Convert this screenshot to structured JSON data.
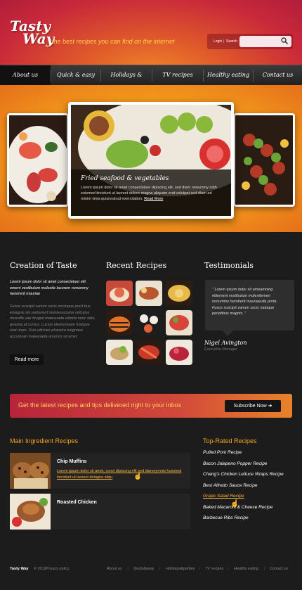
{
  "header": {
    "logo_line1": "Tasty",
    "logo_line2": "Way",
    "tagline": "the best recipes you can find on the internet",
    "login": "Login",
    "search": "Search",
    "search_placeholder": ""
  },
  "nav": [
    "About us",
    "Quick & easy",
    "Holidays & parties",
    "TV recipes",
    "Healthy eating",
    "Contact us"
  ],
  "slider": {
    "title": "Fried seafood & vegetables",
    "text": "Lorem ipsum dolor sit amet consectetuer dipiscing elit, sed diam nonummy nibh euismod tincidunt ut laoreet dolore magna aliquam erat volutpat sed diam ad minim vinia quisnostrud exercitation.",
    "more": "Read More"
  },
  "creation": {
    "title": "Creation of Taste",
    "lead": "Lorem ipsum dolor sit amet consectetuer elit ement vestibulum molestie lacorem nonummy hendrerit mauriae",
    "body": "Fusce suscipit varium socis noctoque pocit bus emagnis dis parturient montesascetur ridiculus musvilla uae feugiat malesuada odiorbi nunc odio, gravida at cursus. Luctus elementuem tristique erat orem. Duis ultricies pharetra magnase accumsan malesuada orcence sit amet.",
    "btn": "Read more"
  },
  "recent": {
    "title": "Recent Recipes"
  },
  "testimonials": {
    "title": "Testimonials",
    "quote": "\" Lorem ipsum dolor sit ameamning elitement vestibulum molestiemen nonummy hendrerit mauriaeulla porta. Fusce suscipit varium socis natoque penatibus magnis. \"",
    "name": "Nigel Avington",
    "role": "Executive Manager"
  },
  "banner": {
    "text": "Get the latest recipes and tips delivered right to your inbox",
    "btn": "Subscribe Now"
  },
  "main_ingredient": {
    "title": "Main Ingredient Recipes",
    "items": [
      {
        "title": "Chip Muffins",
        "desc": "Lorem ipsum dolor sit amet, consi dipiscing elit sed diamnymnis huismod tincidunt ut laoreet dolagna aliqu"
      },
      {
        "title": "Roasted Chicken",
        "desc": ""
      }
    ]
  },
  "top_rated": {
    "title": "Top-Rated Recipes",
    "items": [
      "Pulled Pork Recipe",
      "Bacon Jalapeno Popper Recipe",
      "Chang's Chicken Lettuce Wraps Recipe",
      "Best Alfredo Sauce Recipe",
      "Grape Salad Recipe",
      "Baked Macaroni & Cheese Recipe",
      "Barbecue Ribs Recipe"
    ]
  },
  "footer": {
    "brand": "Tasty Way",
    "copyright": "© 2012",
    "privacy": "Privacy policy",
    "links": [
      "About us",
      "Quick&easy",
      "Holidays&parties",
      "TV recipes",
      "Healthy eating",
      "Contact us"
    ]
  }
}
